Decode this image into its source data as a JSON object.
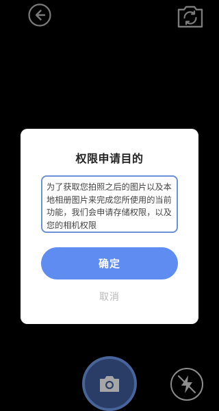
{
  "dialog": {
    "title": "权限申请目的",
    "message": "为了获取您拍照之后的图片以及本地相册图片来完成您所使用的当前功能，我们会申请存储权限，以及您的相机权限",
    "confirm_label": "确定",
    "cancel_label": "取消"
  },
  "icons": {
    "back": "back-arrow-icon",
    "switch_camera": "switch-camera-icon",
    "shutter": "camera-icon",
    "flash": "flash-off-icon"
  },
  "colors": {
    "accent": "#5e8cf0",
    "dialog_border": "#6a90d8",
    "shutter_ring": "#6e9bef",
    "cancel_text": "#b9b9b9"
  }
}
